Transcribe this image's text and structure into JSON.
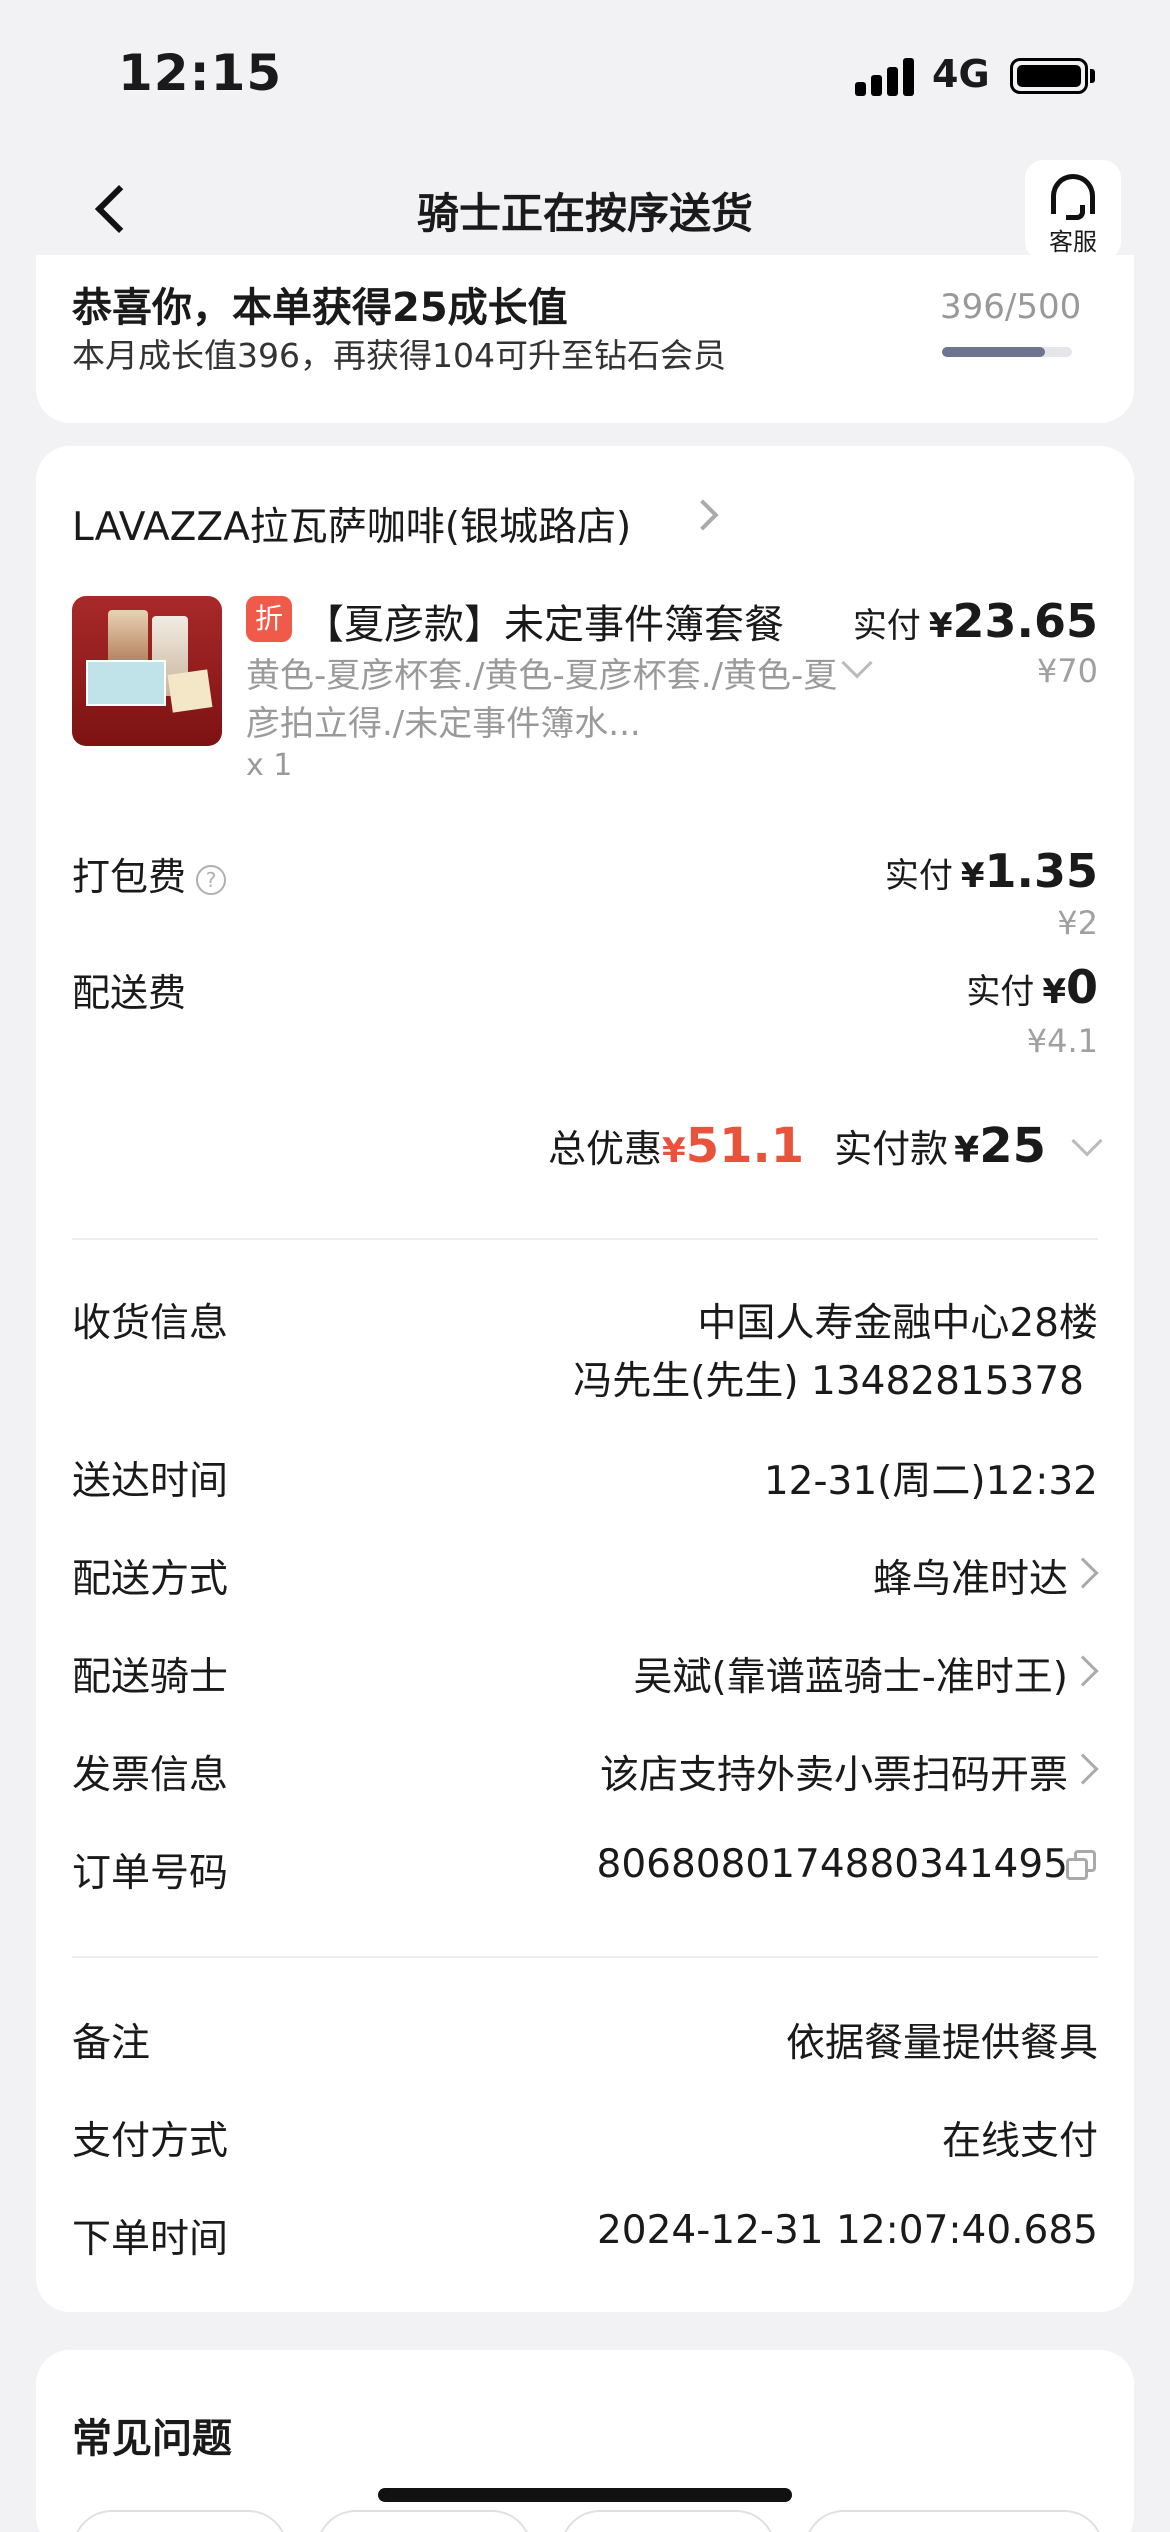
{
  "status_bar": {
    "time": "12:15",
    "network": "4G"
  },
  "nav": {
    "title": "骑士正在按序送货",
    "service_label": "客服"
  },
  "growth": {
    "title": "恭喜你，本单获得25成长值",
    "subtitle": "本月成长值396，再获得104可升至钻石会员",
    "progress_text": "396/500",
    "progress_fraction": 0.792
  },
  "order": {
    "shop_name": "LAVAZZA拉瓦萨咖啡(银城路店)",
    "product": {
      "tag": "折",
      "name": "【夏彦款】未定事件簿套餐",
      "spec": "黄色-夏彦杯套./黄色-夏彦杯套./黄色-夏彦拍立得./未定事件簿水...",
      "qty": "x 1",
      "paid_label": "实付",
      "currency": "¥",
      "paid_amount": "23.65",
      "original_price": "¥70"
    },
    "packing_fee": {
      "label": "打包费",
      "help_icon": "question-circle-icon",
      "paid_label": "实付",
      "currency": "¥",
      "paid_amount": "1.35",
      "original_price": "¥2"
    },
    "delivery_fee": {
      "label": "配送费",
      "paid_label": "实付",
      "currency": "¥",
      "paid_amount": "0",
      "original_price": "¥4.1"
    },
    "totals": {
      "discount_label": "总优惠",
      "discount_currency": "¥",
      "discount_amount": "51.1",
      "pay_label": "实付款",
      "pay_currency": "¥",
      "pay_amount": "25"
    },
    "details": [
      {
        "label": "收货信息",
        "value": "中国人寿金融中心28楼",
        "value2": "冯先生(先生) 13482815378"
      },
      {
        "label": "送达时间",
        "value": "12-31(周二)12:32"
      },
      {
        "label": "配送方式",
        "value": "蜂鸟准时达"
      },
      {
        "label": "配送骑士",
        "value": "吴斌(靠谱蓝骑士-准时王)"
      },
      {
        "label": "发票信息",
        "value": "该店支持外卖小票扫码开票"
      },
      {
        "label": "订单号码",
        "value": "8068080174880341495"
      }
    ],
    "extra": [
      {
        "label": "备注",
        "value": "依据餐量提供餐具"
      },
      {
        "label": "支付方式",
        "value": "在线支付"
      },
      {
        "label": "下单时间",
        "value": "2024-12-31 12:07:40.685"
      }
    ]
  },
  "faq": {
    "title": "常见问题"
  },
  "colors": {
    "accent_red": "#e8533c",
    "background": "#f2f2f4",
    "card": "#ffffff"
  }
}
